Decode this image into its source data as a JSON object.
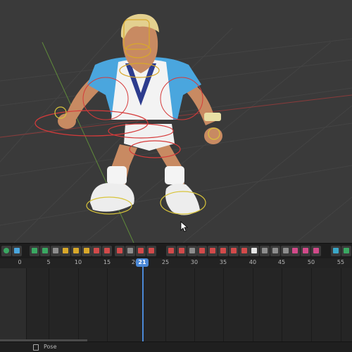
{
  "timeline": {
    "ticks": [
      "0",
      "5",
      "10",
      "15",
      "20",
      "25",
      "30",
      "35",
      "40",
      "45",
      "50",
      "55"
    ],
    "current_frame": "21"
  },
  "status": {
    "mode_label": "Pose"
  },
  "colors": {
    "viewport_bg": "#3a3a3a",
    "playhead": "#4b88d6",
    "rig_control": "#d63a3a",
    "rig_gold": "#d8a82a",
    "shirt": "#4aa6de",
    "skin": "#c88a62",
    "hair": "#e3d08f"
  },
  "icons": [
    "play-icon",
    "keyframe-icon",
    "graph-icon",
    "loop-icon",
    "bone-icon",
    "link-icon",
    "curve-icon",
    "key-select-icon",
    "marker-icon",
    "copy-icon",
    "paste-icon",
    "constraint-icon",
    "camera-icon"
  ]
}
